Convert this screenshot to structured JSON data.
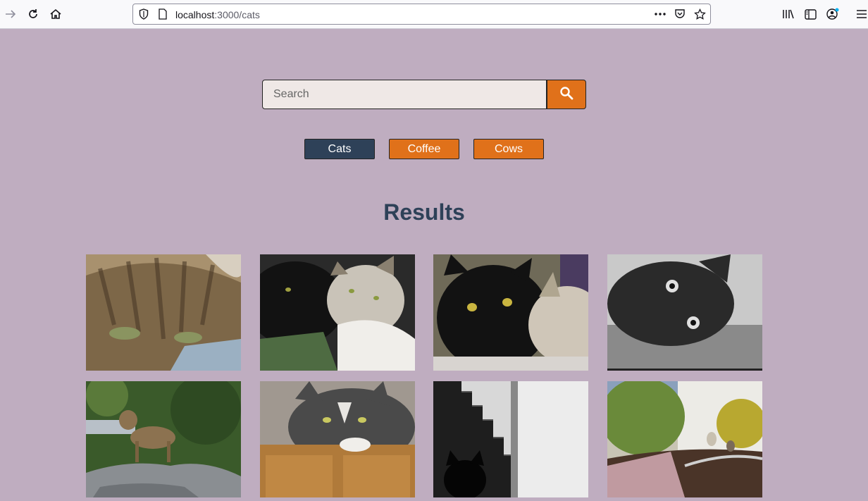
{
  "browser": {
    "url_host": "localhost",
    "url_path": ":3000/cats"
  },
  "search": {
    "placeholder": "Search",
    "value": ""
  },
  "categories": [
    {
      "label": "Cats",
      "active": true
    },
    {
      "label": "Coffee",
      "active": false
    },
    {
      "label": "Cows",
      "active": false
    }
  ],
  "results": {
    "title": "Results",
    "images": [
      {
        "name": "tabby-cat-closeup"
      },
      {
        "name": "black-and-white-cats-cuddling"
      },
      {
        "name": "black-cat-and-tabby"
      },
      {
        "name": "black-cat-upside-down"
      },
      {
        "name": "tabby-cat-on-rocks"
      },
      {
        "name": "grey-cat-on-cabinet"
      },
      {
        "name": "black-cat-on-stairs"
      },
      {
        "name": "cat-in-garden"
      }
    ]
  },
  "colors": {
    "page_background": "#bfadc0",
    "accent_orange": "#e0711a",
    "active_navy": "#2e4158"
  }
}
